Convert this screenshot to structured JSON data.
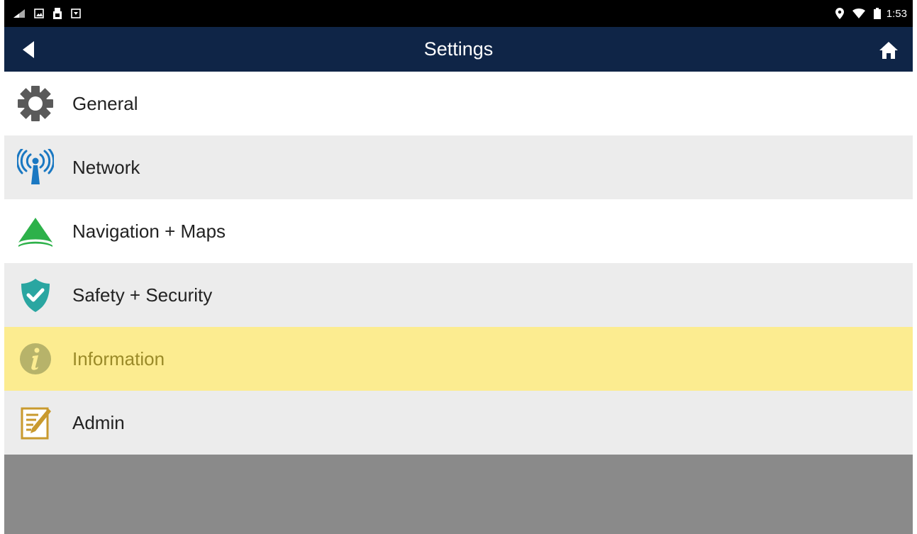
{
  "status_bar": {
    "time": "1:53",
    "left_icons": [
      "cast-icon",
      "image-icon",
      "usb-icon",
      "download-icon"
    ],
    "right_icons": [
      "location-icon",
      "wifi-icon",
      "battery-icon"
    ]
  },
  "app_bar": {
    "title": "Settings",
    "back_icon": "back-arrow-icon",
    "home_icon": "home-icon",
    "background": "#0f2547"
  },
  "menu": {
    "items": [
      {
        "label": "General",
        "icon": "gear-icon",
        "icon_color": "#5a5a5a",
        "selected": false
      },
      {
        "label": "Network",
        "icon": "antenna-icon",
        "icon_color": "#1a78c2",
        "selected": false
      },
      {
        "label": "Navigation + Maps",
        "icon": "navigation-icon",
        "icon_color": "#2db14a",
        "selected": false
      },
      {
        "label": "Safety + Security",
        "icon": "shield-check-icon",
        "icon_color": "#2aa6a1",
        "selected": false
      },
      {
        "label": "Information",
        "icon": "info-icon",
        "icon_color": "#b7b36a",
        "selected": true
      },
      {
        "label": "Admin",
        "icon": "edit-document-icon",
        "icon_color": "#c99a2e",
        "selected": false
      }
    ],
    "selected_color": "#fcec90"
  }
}
